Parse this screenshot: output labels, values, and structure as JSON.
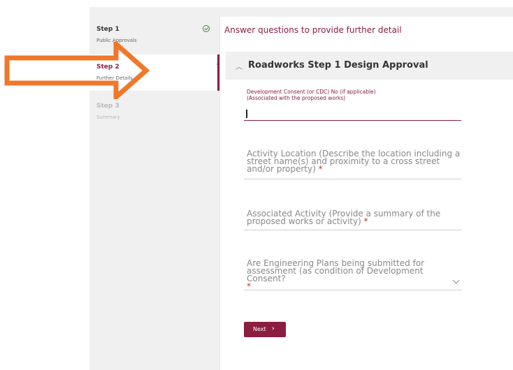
{
  "steps": [
    {
      "title": "Step 1",
      "subtitle": "Public Approvals",
      "state": "completed"
    },
    {
      "title": "Step 2",
      "subtitle": "Further Details",
      "state": "active"
    },
    {
      "title": "Step 3",
      "subtitle": "Summary",
      "state": "upcoming"
    }
  ],
  "main": {
    "instruction": "Answer questions to provide further detail",
    "section_title": "Roadworks Step 1 Design Approval",
    "fields": [
      {
        "label_line1": "Development Consent (or CDC) No (if applicable)",
        "label_line2": "(Associated with the proposed works)",
        "value": ""
      },
      {
        "label_line1": "Activity Location (Describe the location including a",
        "label_line2": "street name(s) and proximity to a cross street",
        "label_line3": "and/or property)",
        "required_mark": "*"
      },
      {
        "label_line1": "Associated Activity (Provide a summary of the",
        "label_line2": "proposed works or activity)",
        "required_mark": "*"
      },
      {
        "label_line1": "Are Engineering Plans being submitted for",
        "label_line2": "assessment (as condition of Development Consent?",
        "required_mark": "*"
      }
    ],
    "next_label": "Next",
    "next_icon": "›"
  },
  "colors": {
    "accent": "#8b1e3f",
    "annotation_arrow": "#f0782a",
    "completed": "#2e8b3a",
    "required": "#c0392b"
  },
  "icons": {
    "completed_step": "check-circle-icon",
    "collapse": "chevron-up-icon",
    "dropdown": "chevron-down-icon",
    "annotation": "arrow-right-icon"
  }
}
